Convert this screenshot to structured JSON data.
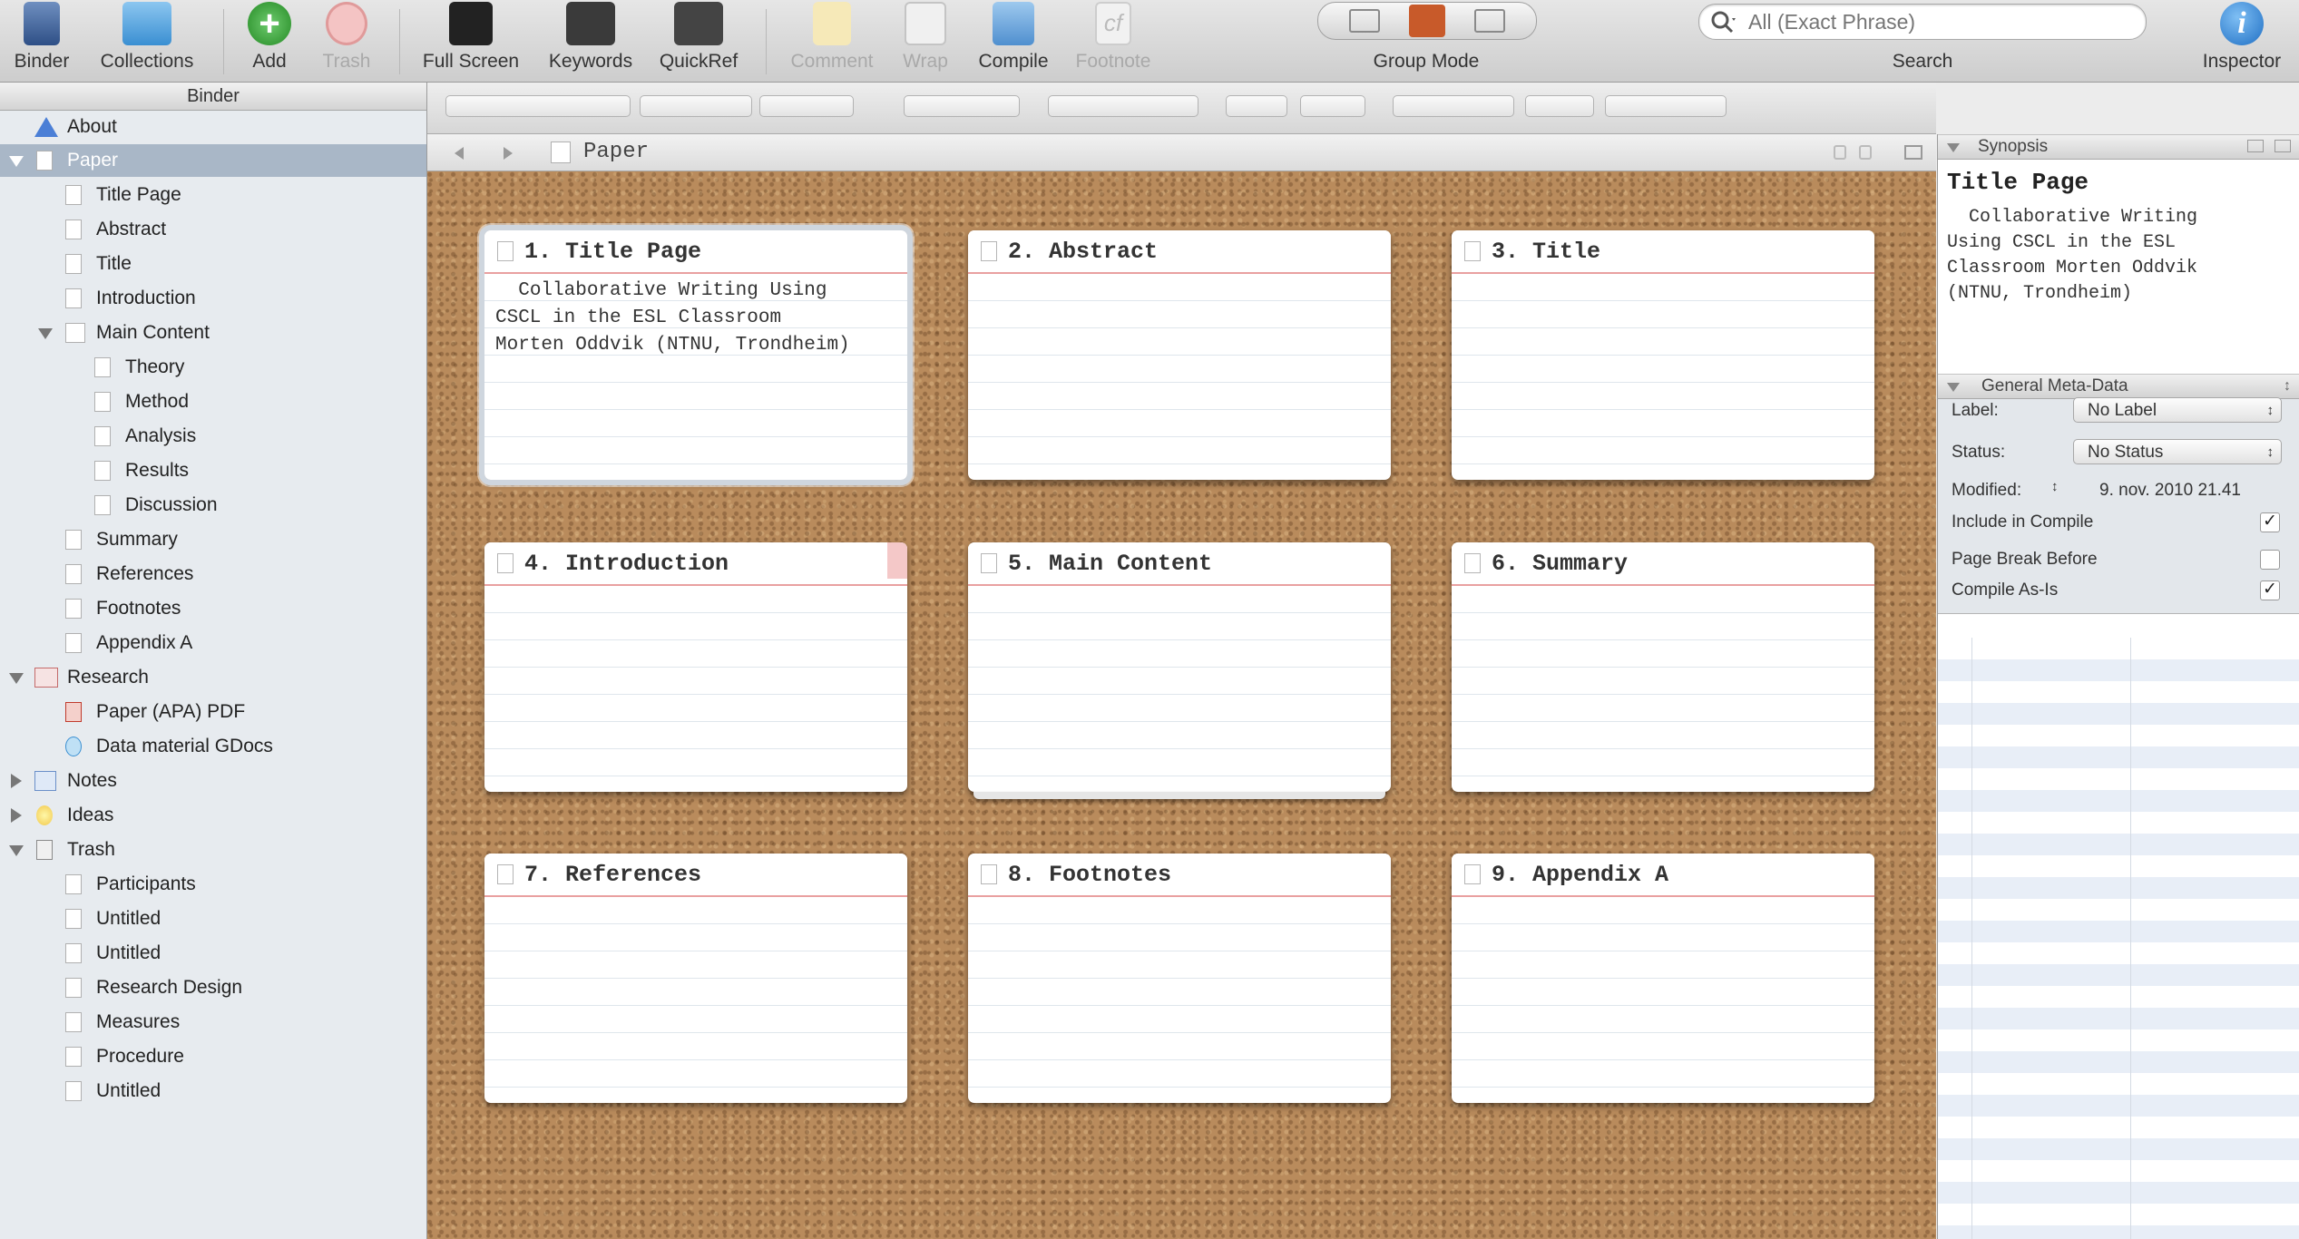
{
  "toolbar": {
    "binder": "Binder",
    "collections": "Collections",
    "add": "Add",
    "trash": "Trash",
    "full_screen": "Full Screen",
    "keywords": "Keywords",
    "quickref": "QuickRef",
    "comment": "Comment",
    "wrap": "Wrap",
    "compile": "Compile",
    "footnote": "Footnote",
    "group_mode": "Group Mode",
    "search_placeholder": "All (Exact Phrase)",
    "search": "Search",
    "inspector": "Inspector"
  },
  "binder": {
    "header": "Binder",
    "items": [
      {
        "label": "About"
      },
      {
        "label": "Paper"
      },
      {
        "label": "Title Page"
      },
      {
        "label": "Abstract"
      },
      {
        "label": "Title"
      },
      {
        "label": "Introduction"
      },
      {
        "label": "Main Content"
      },
      {
        "label": "Theory"
      },
      {
        "label": "Method"
      },
      {
        "label": "Analysis"
      },
      {
        "label": "Results"
      },
      {
        "label": "Discussion"
      },
      {
        "label": "Summary"
      },
      {
        "label": "References"
      },
      {
        "label": "Footnotes"
      },
      {
        "label": "Appendix A"
      },
      {
        "label": "Research"
      },
      {
        "label": "Paper (APA) PDF"
      },
      {
        "label": "Data material GDocs"
      },
      {
        "label": "Notes"
      },
      {
        "label": "Ideas"
      },
      {
        "label": "Trash"
      },
      {
        "label": "Participants"
      },
      {
        "label": "Untitled"
      },
      {
        "label": "Untitled"
      },
      {
        "label": "Research Design"
      },
      {
        "label": "Measures"
      },
      {
        "label": "Procedure"
      },
      {
        "label": "Untitled"
      }
    ]
  },
  "header": {
    "title": "Paper"
  },
  "cards": [
    {
      "title": "1. Title Page",
      "synopsis": "  Collaborative Writing Using\nCSCL in the ESL Classroom\nMorten Oddvik (NTNU, Trondheim)"
    },
    {
      "title": "2. Abstract",
      "synopsis": ""
    },
    {
      "title": "3. Title",
      "synopsis": ""
    },
    {
      "title": "4. Introduction",
      "synopsis": ""
    },
    {
      "title": "5. Main Content",
      "synopsis": ""
    },
    {
      "title": "6. Summary",
      "synopsis": ""
    },
    {
      "title": "7. References",
      "synopsis": ""
    },
    {
      "title": "8. Footnotes",
      "synopsis": ""
    },
    {
      "title": "9. Appendix A",
      "synopsis": ""
    }
  ],
  "inspector": {
    "synopsis_header": "Synopsis",
    "synopsis_title": "Title Page",
    "synopsis_text": "  Collaborative Writing\nUsing CSCL in the ESL\nClassroom Morten Oddvik\n(NTNU, Trondheim)",
    "meta_header": "General Meta-Data",
    "label_label": "Label:",
    "label_value": "No Label",
    "status_label": "Status:",
    "status_value": "No Status",
    "modified_label": "Modified:",
    "modified_value": "9. nov. 2010 21.41",
    "include_compile": "Include in Compile",
    "page_break": "Page Break Before",
    "compile_as_is": "Compile As-Is"
  },
  "colors": {
    "accent": "#a9b7c7",
    "cork": "#b98b5c",
    "card_rule": "#e9a0a0"
  }
}
